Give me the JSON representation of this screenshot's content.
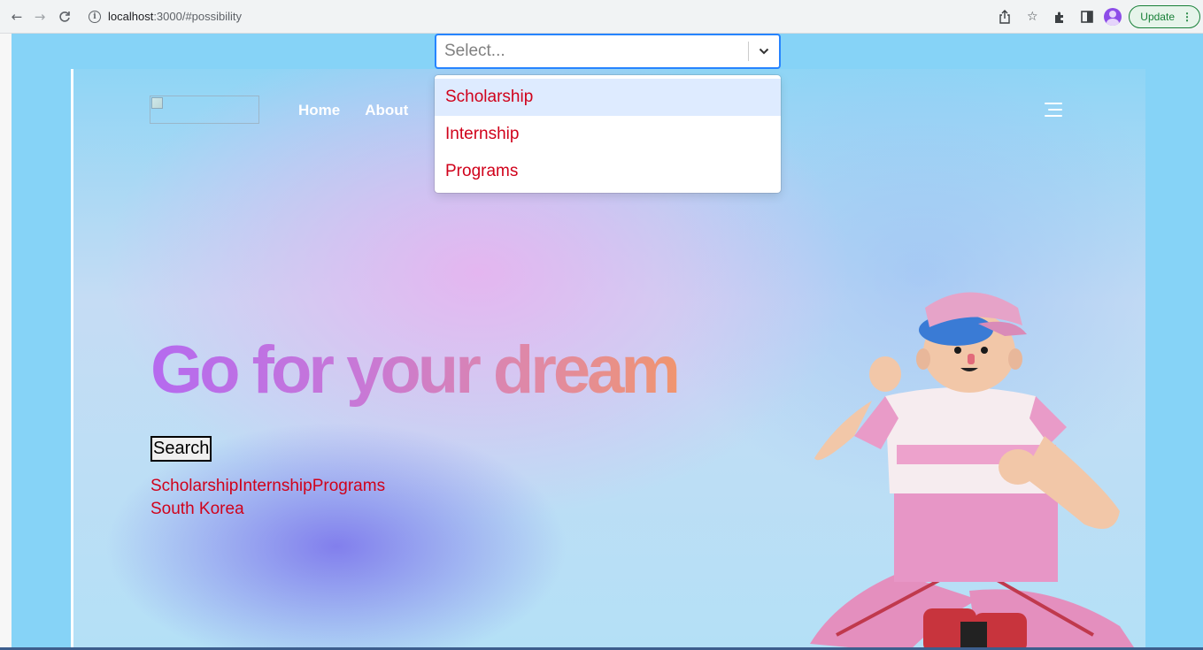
{
  "browser": {
    "url_host": "localhost",
    "url_rest": ":3000/#possibility",
    "update_label": "Update",
    "update_menu": "⋮"
  },
  "nav": {
    "items": [
      {
        "label": "Home"
      },
      {
        "label": "About"
      }
    ]
  },
  "hero": {
    "headline": "Go for your dream",
    "search_label": "Search",
    "result_categories": "ScholarshipInternshipPrograms",
    "result_country": "South Korea"
  },
  "select": {
    "placeholder": "Select...",
    "options": [
      {
        "label": "Scholarship",
        "focused": true
      },
      {
        "label": "Internship",
        "focused": false
      },
      {
        "label": "Programs",
        "focused": false
      }
    ]
  },
  "colors": {
    "accent": "#2684ff",
    "option_text": "#d0021b",
    "update_green": "#188038"
  }
}
